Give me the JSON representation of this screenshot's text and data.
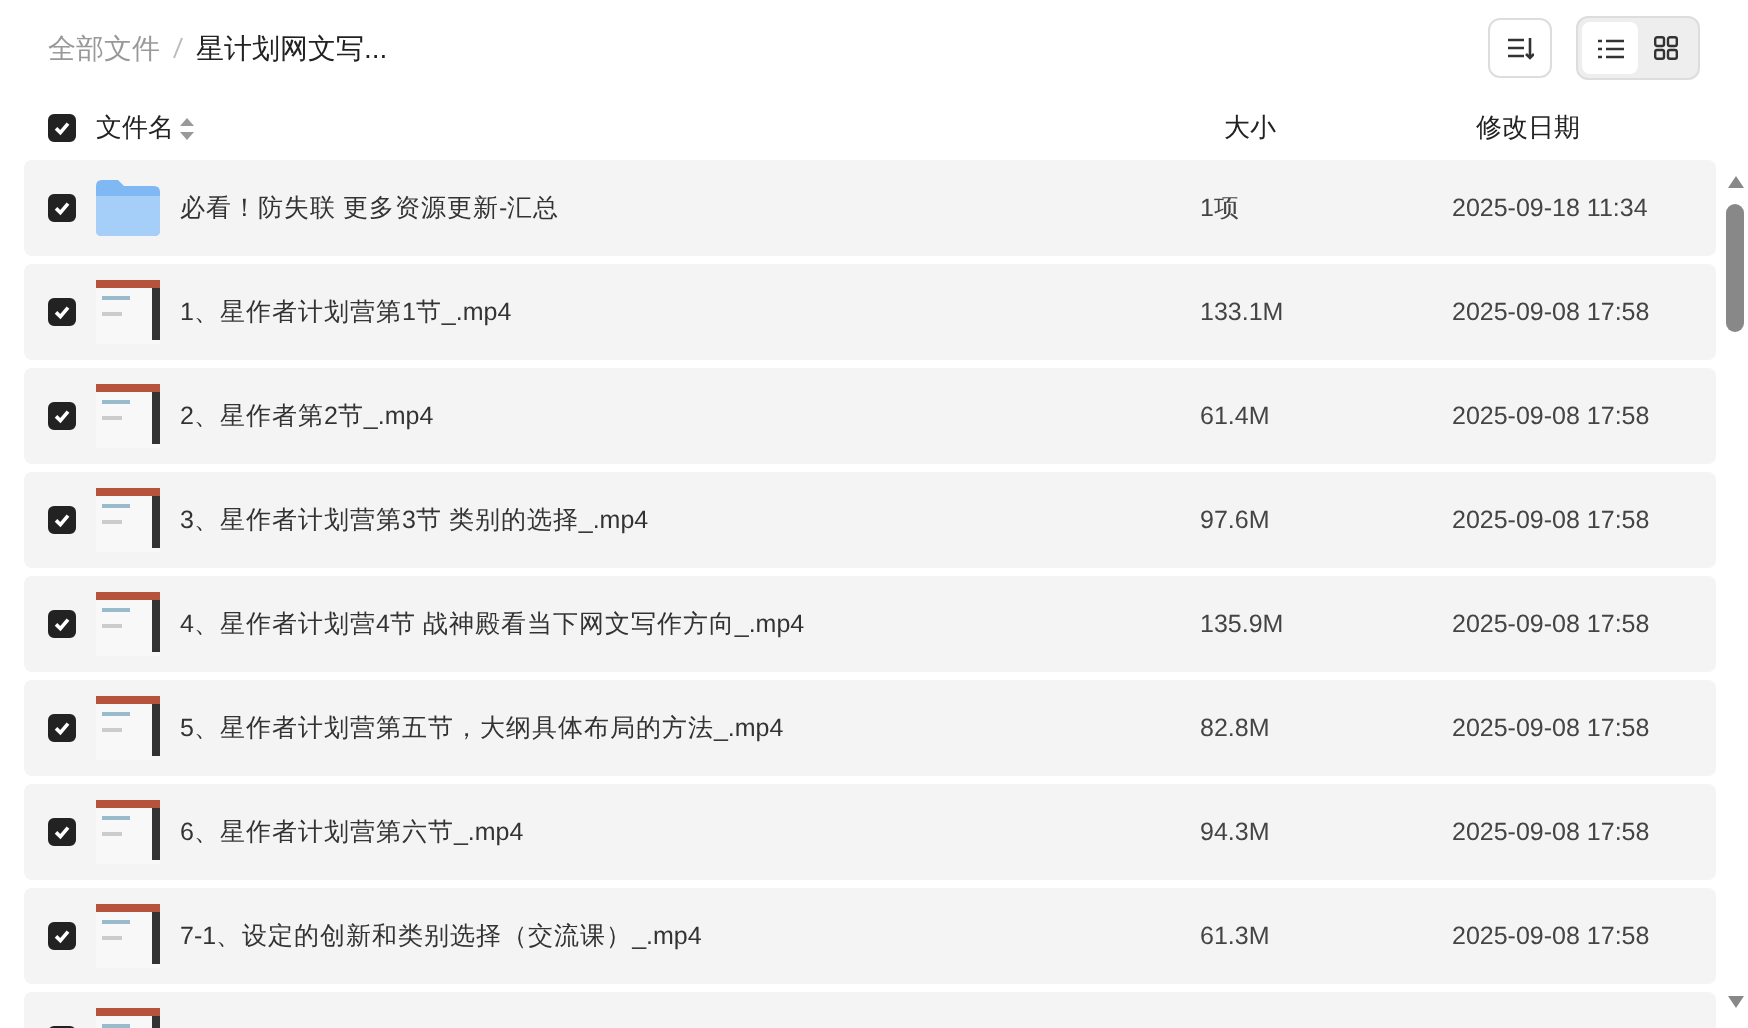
{
  "breadcrumb": [
    {
      "label": "全部文件",
      "current": false
    },
    {
      "label": "星计划网文写...",
      "current": true
    }
  ],
  "view_modes": [
    {
      "kind": "list",
      "selected": true
    },
    {
      "kind": "grid",
      "selected": false
    }
  ],
  "header": {
    "checked": true,
    "columns": [
      "文件名",
      "大小",
      "修改日期"
    ]
  },
  "rows": [
    {
      "kind": "folder",
      "checked": true,
      "name": "必看！防失联 更多资源更新-汇总",
      "size": "1项",
      "modified": "2025-09-18 11:34"
    },
    {
      "kind": "video",
      "checked": true,
      "name": "1、星作者计划营第1节_.mp4",
      "size": "133.1M",
      "modified": "2025-09-08 17:58"
    },
    {
      "kind": "video",
      "checked": true,
      "name": "2、星作者第2节_.mp4",
      "size": "61.4M",
      "modified": "2025-09-08 17:58"
    },
    {
      "kind": "video",
      "checked": true,
      "name": "3、星作者计划营第3节 类别的选择_.mp4",
      "size": "97.6M",
      "modified": "2025-09-08 17:58"
    },
    {
      "kind": "video",
      "checked": true,
      "name": "4、星作者计划营4节 战神殿看当下网文写作方向_.mp4",
      "size": "135.9M",
      "modified": "2025-09-08 17:58"
    },
    {
      "kind": "video",
      "checked": true,
      "name": "5、星作者计划营第五节，大纲具体布局的方法_.mp4",
      "size": "82.8M",
      "modified": "2025-09-08 17:58"
    },
    {
      "kind": "video",
      "checked": true,
      "name": "6、星作者计划营第六节_.mp4",
      "size": "94.3M",
      "modified": "2025-09-08 17:58"
    },
    {
      "kind": "video",
      "checked": true,
      "name": "7-1、设定的创新和类别选择（交流课）_.mp4",
      "size": "61.3M",
      "modified": "2025-09-08 17:58"
    },
    {
      "kind": "video",
      "checked": true
    }
  ]
}
